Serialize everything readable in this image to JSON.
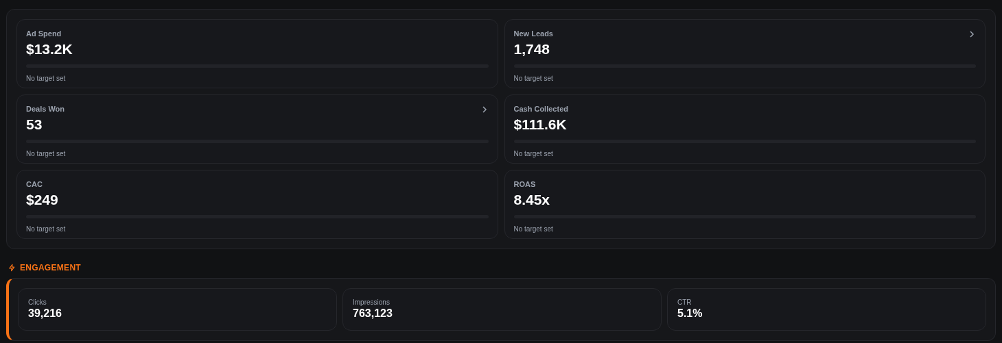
{
  "kpis": [
    {
      "label": "Ad Spend",
      "value": "$13.2K",
      "level": 0,
      "note": "No target set",
      "has_link": false
    },
    {
      "label": "New Leads",
      "value": "1,748",
      "level": 0,
      "note": "No target set",
      "has_link": true
    },
    {
      "label": "Deals Won",
      "value": "53",
      "level": 0,
      "note": "No target set",
      "has_link": true
    },
    {
      "label": "Cash Collected",
      "value": "$111.6K",
      "level": 0,
      "note": "No target set",
      "has_link": false
    },
    {
      "label": "CAC",
      "value": "$249",
      "level": 0,
      "note": "No target set",
      "has_link": false
    },
    {
      "label": "ROAS",
      "value": "8.45x",
      "level": 0,
      "note": "No target set",
      "has_link": false
    }
  ],
  "engagement": {
    "title": "ENGAGEMENT",
    "metrics": [
      {
        "label": "Clicks",
        "value": "39,216"
      },
      {
        "label": "Impressions",
        "value": "763,123"
      },
      {
        "label": "CTR",
        "value": "5.1%"
      }
    ]
  }
}
